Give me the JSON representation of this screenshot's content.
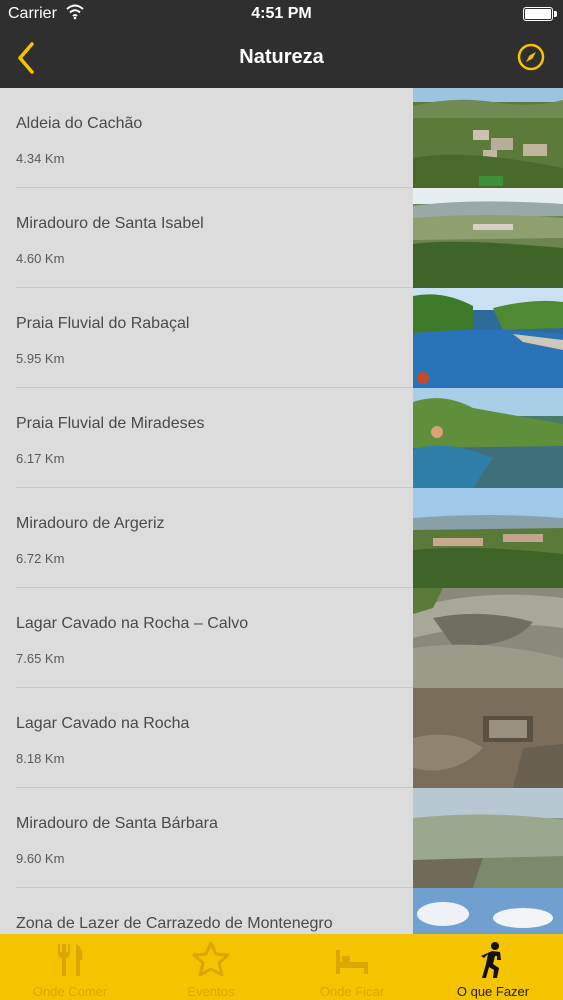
{
  "status": {
    "carrier": "Carrier",
    "time": "4:51 PM"
  },
  "nav": {
    "title": "Natureza"
  },
  "colors": {
    "accent": "#f5c400",
    "bar": "#2f2f2f",
    "list_bg": "#dcdcdc"
  },
  "items": [
    {
      "name": "Aldeia do Cachão",
      "distance": "4.34 Km"
    },
    {
      "name": "Miradouro de Santa Isabel",
      "distance": "4.60 Km"
    },
    {
      "name": "Praia Fluvial do Rabaçal",
      "distance": "5.95 Km"
    },
    {
      "name": "Praia Fluvial de Miradeses",
      "distance": "6.17 Km"
    },
    {
      "name": "Miradouro de Argeriz",
      "distance": "6.72 Km"
    },
    {
      "name": "Lagar Cavado na Rocha – Calvo",
      "distance": "7.65 Km"
    },
    {
      "name": "Lagar Cavado na Rocha",
      "distance": "8.18 Km"
    },
    {
      "name": "Miradouro de Santa Bárbara",
      "distance": "9.60 Km"
    },
    {
      "name": "Zona de Lazer de Carrazedo de Montenegro",
      "distance": ""
    }
  ],
  "tabs": [
    {
      "label": "Onde Comer",
      "icon": "fork-knife-icon"
    },
    {
      "label": "Eventos",
      "icon": "star-icon"
    },
    {
      "label": "Onde Ficar",
      "icon": "bed-icon"
    },
    {
      "label": "O que Fazer",
      "icon": "hiker-icon",
      "active": true
    }
  ]
}
